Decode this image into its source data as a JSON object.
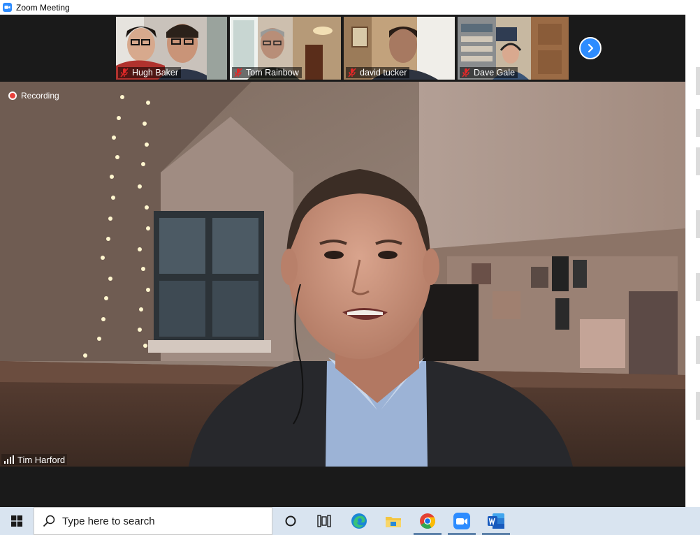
{
  "window": {
    "title": "Zoom Meeting",
    "icon": "zoom-app-icon"
  },
  "thumbnails": [
    {
      "name": "Hugh Baker",
      "muted": true
    },
    {
      "name": "Tom Rainbow",
      "muted": true
    },
    {
      "name": "david tucker",
      "muted": true
    },
    {
      "name": "Dave Gale",
      "muted": true
    }
  ],
  "next_page_icon": "chevron-right-icon",
  "main_video": {
    "recording_label": "Recording",
    "speaker_name": "Tim Harford",
    "signal_icon": "signal-bars-icon"
  },
  "taskbar": {
    "search_placeholder": "Type here to search",
    "icons": [
      "windows-start-icon",
      "cortana-icon",
      "task-view-icon",
      "edge-icon",
      "file-explorer-icon",
      "chrome-icon",
      "zoom-icon",
      "word-icon"
    ]
  },
  "colors": {
    "zoom_blue": "#2d8cff",
    "recording_red": "#e8413c",
    "taskbar": "#d9e4f0",
    "mute_red": "#e02828"
  }
}
